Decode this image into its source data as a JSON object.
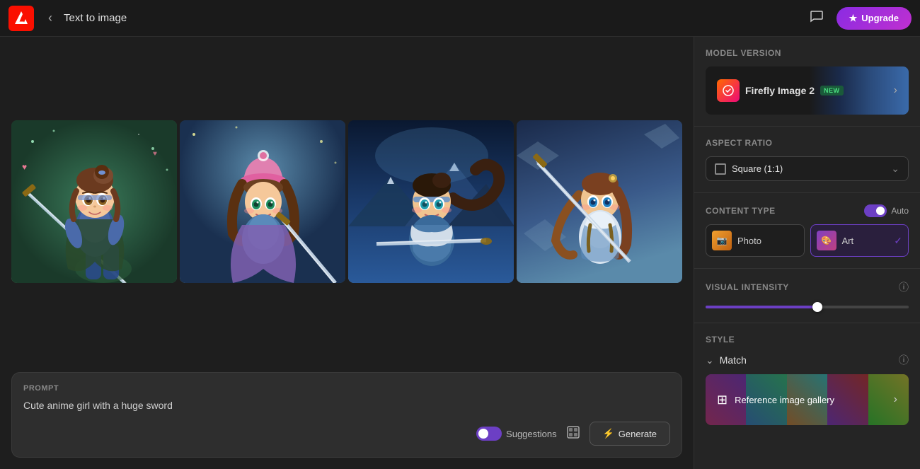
{
  "header": {
    "title": "Text to image",
    "back_button": "←",
    "upgrade_label": "Upgrade",
    "upgrade_icon": "★"
  },
  "sidebar": {
    "model_section": {
      "title": "Model version",
      "model_name": "Firefly Image 2",
      "new_badge": "NEW"
    },
    "aspect_ratio": {
      "title": "Aspect ratio",
      "value": "Square (1:1)"
    },
    "content_type": {
      "title": "Content type",
      "auto_label": "Auto",
      "options": [
        {
          "label": "Photo",
          "id": "photo"
        },
        {
          "label": "Art",
          "id": "art",
          "selected": true
        }
      ]
    },
    "visual_intensity": {
      "title": "Visual intensity",
      "value": 55
    },
    "style": {
      "title": "Style",
      "match_label": "Match",
      "ref_gallery_label": "Reference image gallery"
    }
  },
  "prompt": {
    "label": "Prompt",
    "text": "Cute anime girl with a huge sword",
    "suggestions_label": "Suggestions",
    "generate_label": "Generate"
  },
  "images": [
    {
      "id": "img1",
      "alt": "Anime girl with sword 1"
    },
    {
      "id": "img2",
      "alt": "Anime girl with sword 2"
    },
    {
      "id": "img3",
      "alt": "Anime girl with sword 3"
    },
    {
      "id": "img4",
      "alt": "Anime girl with sword 4"
    }
  ]
}
